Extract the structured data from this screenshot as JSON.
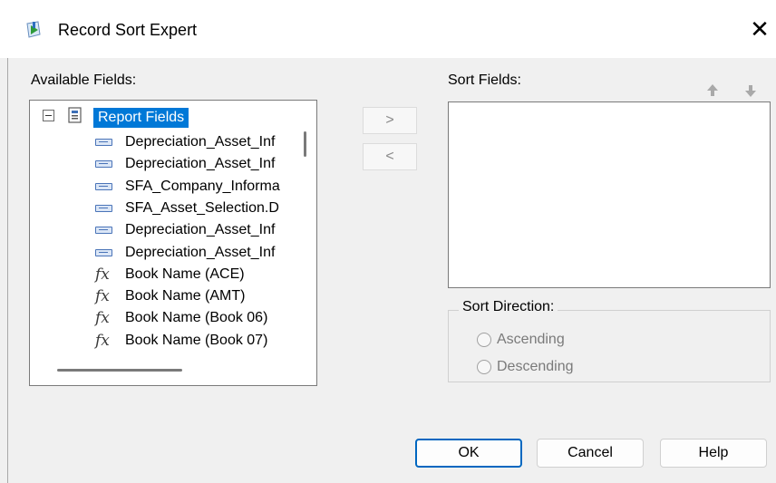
{
  "window": {
    "title": "Record Sort Expert",
    "close_glyph": "✕",
    "icon": "record-sort-expert-icon"
  },
  "available_fields": {
    "label": "Available Fields:",
    "root": {
      "label": "Report Fields",
      "expander": "minus",
      "icon": "report-fields-icon"
    },
    "items": [
      {
        "type": "field",
        "label": "Depreciation_Asset_Inf",
        "icon": "database-field-icon"
      },
      {
        "type": "field",
        "label": "Depreciation_Asset_Inf",
        "icon": "database-field-icon"
      },
      {
        "type": "field",
        "label": "SFA_Company_Informa",
        "icon": "database-field-icon"
      },
      {
        "type": "field",
        "label": "SFA_Asset_Selection.D",
        "icon": "database-field-icon"
      },
      {
        "type": "field",
        "label": "Depreciation_Asset_Inf",
        "icon": "database-field-icon"
      },
      {
        "type": "field",
        "label": "Depreciation_Asset_Inf",
        "icon": "database-field-icon"
      },
      {
        "type": "formula",
        "label": "Book Name (ACE)",
        "icon": "formula-icon"
      },
      {
        "type": "formula",
        "label": "Book Name (AMT)",
        "icon": "formula-icon"
      },
      {
        "type": "formula",
        "label": "Book Name (Book 06)",
        "icon": "formula-icon"
      },
      {
        "type": "formula",
        "label": "Book Name (Book 07)",
        "icon": "formula-icon"
      }
    ],
    "fx_glyph": "fx"
  },
  "transfer": {
    "add_label": ">",
    "remove_label": "<"
  },
  "sort_fields": {
    "label": "Sort Fields:",
    "items": [],
    "move_up_icon": "arrow-up-icon",
    "move_down_icon": "arrow-down-icon"
  },
  "sort_direction": {
    "label": "Sort Direction:",
    "options": [
      {
        "label": "Ascending",
        "selected": false,
        "enabled": false
      },
      {
        "label": "Descending",
        "selected": false,
        "enabled": false
      }
    ]
  },
  "buttons": {
    "ok": "OK",
    "cancel": "Cancel",
    "help": "Help"
  },
  "colors": {
    "selection": "#0078d7",
    "default_button_border": "#0067c0",
    "dialog_bg": "#f0f0f0"
  }
}
